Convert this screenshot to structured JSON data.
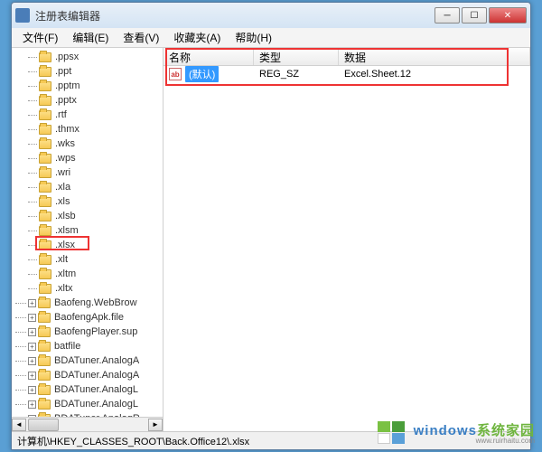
{
  "window": {
    "title": "注册表编辑器"
  },
  "menu": {
    "file": "文件(F)",
    "edit": "编辑(E)",
    "view": "查看(V)",
    "fav": "收藏夹(A)",
    "help": "帮助(H)"
  },
  "tree": {
    "items": [
      {
        "label": ".ppsx",
        "lvl": 1
      },
      {
        "label": ".ppt",
        "lvl": 1
      },
      {
        "label": ".pptm",
        "lvl": 1
      },
      {
        "label": ".pptx",
        "lvl": 1
      },
      {
        "label": ".rtf",
        "lvl": 1
      },
      {
        "label": ".thmx",
        "lvl": 1
      },
      {
        "label": ".wks",
        "lvl": 1
      },
      {
        "label": ".wps",
        "lvl": 1
      },
      {
        "label": ".wri",
        "lvl": 1
      },
      {
        "label": ".xla",
        "lvl": 1
      },
      {
        "label": ".xls",
        "lvl": 1
      },
      {
        "label": ".xlsb",
        "lvl": 1
      },
      {
        "label": ".xlsm",
        "lvl": 1
      },
      {
        "label": ".xlsx",
        "lvl": 1,
        "highlight": true
      },
      {
        "label": ".xlt",
        "lvl": 1
      },
      {
        "label": ".xltm",
        "lvl": 1
      },
      {
        "label": ".xltx",
        "lvl": 1
      },
      {
        "label": "Baofeng.WebBrow",
        "lvl": 2,
        "exp": true
      },
      {
        "label": "BaofengApk.file",
        "lvl": 2,
        "exp": true
      },
      {
        "label": "BaofengPlayer.sup",
        "lvl": 2,
        "exp": true
      },
      {
        "label": "batfile",
        "lvl": 2,
        "exp": true
      },
      {
        "label": "BDATuner.AnalogA",
        "lvl": 2,
        "exp": true
      },
      {
        "label": "BDATuner.AnalogA",
        "lvl": 2,
        "exp": true
      },
      {
        "label": "BDATuner.AnalogL",
        "lvl": 2,
        "exp": true
      },
      {
        "label": "BDATuner.AnalogL",
        "lvl": 2,
        "exp": true
      },
      {
        "label": "BDATuner.AnalogR",
        "lvl": 2,
        "exp": true
      }
    ]
  },
  "list": {
    "cols": {
      "name": "名称",
      "type": "类型",
      "data": "数据"
    },
    "rows": [
      {
        "name": "(默认)",
        "type": "REG_SZ",
        "data": "Excel.Sheet.12",
        "selected": true
      }
    ],
    "icon_label": "ab"
  },
  "status": {
    "path": "计算机\\HKEY_CLASSES_ROOT\\Back.Office12\\.xlsx"
  },
  "watermark": {
    "brand_a": "windows",
    "brand_b": "系统家园",
    "sub": "www.ruirhaitu.com"
  }
}
